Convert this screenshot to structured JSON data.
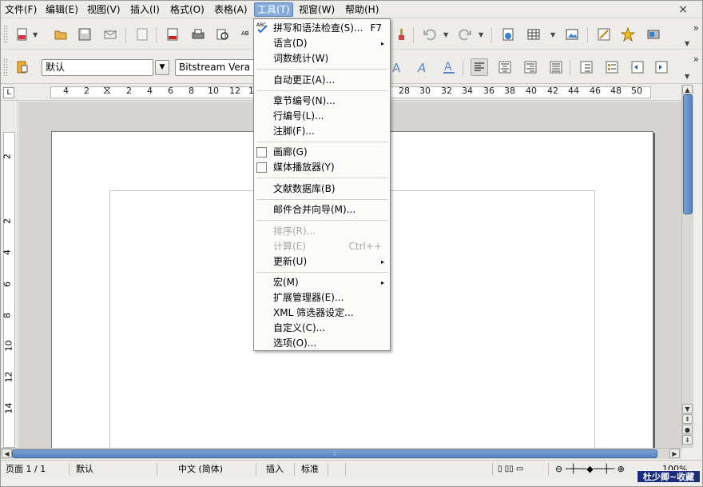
{
  "menubar": {
    "items": [
      "文件(F)",
      "编辑(E)",
      "视图(V)",
      "插入(I)",
      "格式(O)",
      "表格(A)",
      "工具(T)",
      "视窗(W)",
      "帮助(H)"
    ],
    "active": "工具(T)",
    "close": "×"
  },
  "toolbar2": {
    "style_value": "默认",
    "font_value": "Bitstream Vera"
  },
  "ruler": {
    "numbers": [
      "4",
      "2",
      "2",
      "4",
      "6",
      "8",
      "10",
      "12",
      "1",
      "28",
      "30",
      "32",
      "34",
      "36",
      "38",
      "40",
      "42",
      "44",
      "46",
      "48",
      "50"
    ]
  },
  "vruler": {
    "numbers": [
      "2",
      "2",
      "4",
      "6",
      "8",
      "10",
      "12",
      "14"
    ]
  },
  "tools_menu": {
    "items": [
      {
        "label": "拼写和语法检查(S)...",
        "shortcut": "F7",
        "icon": "spellcheck-icon"
      },
      {
        "label": "语言(D)",
        "submenu": true
      },
      {
        "label": "词数统计(W)"
      },
      {
        "label": "自动更正(A)..."
      },
      {
        "label": "章节编号(N)..."
      },
      {
        "label": "行编号(L)..."
      },
      {
        "label": "注脚(F)..."
      },
      {
        "label": "画廊(G)",
        "checkbox": true
      },
      {
        "label": "媒体播放器(Y)",
        "checkbox": true
      },
      {
        "label": "文献数据库(B)"
      },
      {
        "label": "邮件合并向导(M)..."
      },
      {
        "label": "排序(R)...",
        "disabled": true
      },
      {
        "label": "计算(E)",
        "shortcut": "Ctrl++",
        "disabled": true
      },
      {
        "label": "更新(U)",
        "submenu": true
      },
      {
        "label": "宏(M)",
        "submenu": true
      },
      {
        "label": "扩展管理器(E)..."
      },
      {
        "label": "XML 筛选器设定..."
      },
      {
        "label": "自定义(C)..."
      },
      {
        "label": "选项(O)..."
      }
    ]
  },
  "statusbar": {
    "page": "页面 1 / 1",
    "style": "默认",
    "language": "中文 (简体)",
    "insert_mode": "插入",
    "selection_mode": "标准",
    "zoom": "100%"
  },
  "watermark": "杜少卿~收藏",
  "colors": {
    "accent": "#86abd9",
    "scroll_thumb": "#5483c1"
  }
}
